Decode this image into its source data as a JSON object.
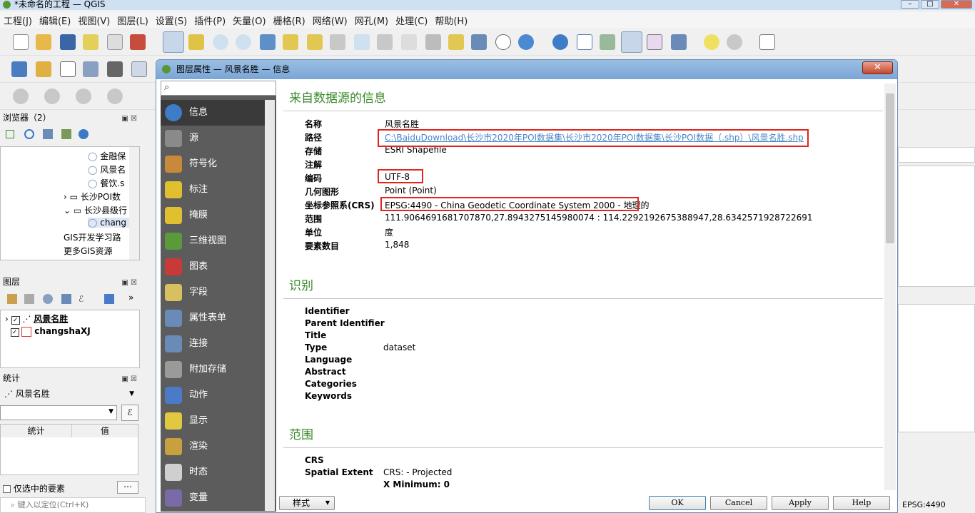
{
  "window": {
    "title": "*未命名的工程 — QGIS"
  },
  "menu": [
    "工程(J)",
    "编辑(E)",
    "视图(V)",
    "图层(L)",
    "设置(S)",
    "插件(P)",
    "矢量(O)",
    "栅格(R)",
    "网络(W)",
    "网孔(M)",
    "处理(C)",
    "帮助(H)"
  ],
  "browser": {
    "title": "浏览器（2）",
    "items": [
      "金融保",
      "风景名",
      "餐饮.s",
      "长沙POI数",
      "长沙县级行",
      "chang",
      "GIS开发学习路",
      "更多GIS资源"
    ]
  },
  "layers": {
    "title": "图层",
    "items": [
      "风景名胜",
      "changshaXJ"
    ]
  },
  "stats": {
    "title": "统计",
    "layer": "风景名胜",
    "col_stat": "统计",
    "col_value": "值",
    "selected_only": "仅选中的要素"
  },
  "locator": {
    "placeholder": "键入以定位(Ctrl+K)"
  },
  "dialog": {
    "title": "图层属性 — 风景名胜 — 信息",
    "sidebar": [
      "信息",
      "源",
      "符号化",
      "标注",
      "掩膜",
      "三维视图",
      "图表",
      "字段",
      "属性表单",
      "连接",
      "附加存储",
      "动作",
      "显示",
      "渲染",
      "时态",
      "变量"
    ],
    "section_source": "来自数据源的信息",
    "source_rows": [
      {
        "label": "名称",
        "value": "风景名胜"
      },
      {
        "label": "路径",
        "value": "C:\\BaiduDownload\\长沙市2020年POI数据集\\长沙市2020年POI数据集\\长沙POI数据（.shp）\\风景名胜.shp"
      },
      {
        "label": "存储",
        "value": "ESRI Shapefile"
      },
      {
        "label": "注解",
        "value": ""
      },
      {
        "label": "编码",
        "value": "UTF-8"
      },
      {
        "label": "几何图形",
        "value": "Point (Point)"
      },
      {
        "label": "坐标参照系(CRS)",
        "value": "EPSG:4490 - China Geodetic Coordinate System 2000 - 地理的"
      },
      {
        "label": "范围",
        "value": "111.9064691681707870,27.8943275145980074 : 114.2292192675388947,28.6342571928722691"
      },
      {
        "label": "单位",
        "value": "度"
      },
      {
        "label": "要素数目",
        "value": "1,848"
      }
    ],
    "section_ident": "识别",
    "ident_rows": [
      {
        "label": "Identifier",
        "value": ""
      },
      {
        "label": "Parent Identifier",
        "value": ""
      },
      {
        "label": "Title",
        "value": ""
      },
      {
        "label": "Type",
        "value": "dataset"
      },
      {
        "label": "Language",
        "value": ""
      },
      {
        "label": "Abstract",
        "value": ""
      },
      {
        "label": "Categories",
        "value": ""
      },
      {
        "label": "Keywords",
        "value": ""
      }
    ],
    "section_extent": "范围",
    "extent_rows": [
      {
        "label": "CRS",
        "value": ""
      },
      {
        "label": "Spatial Extent",
        "value": "CRS: - Projected"
      },
      {
        "label": "",
        "value": "X Minimum: 0"
      }
    ],
    "buttons": {
      "style": "样式",
      "ok": "OK",
      "cancel": "Cancel",
      "apply": "Apply",
      "help": "Help"
    }
  },
  "statusbar": {
    "crs": "EPSG:4490"
  }
}
